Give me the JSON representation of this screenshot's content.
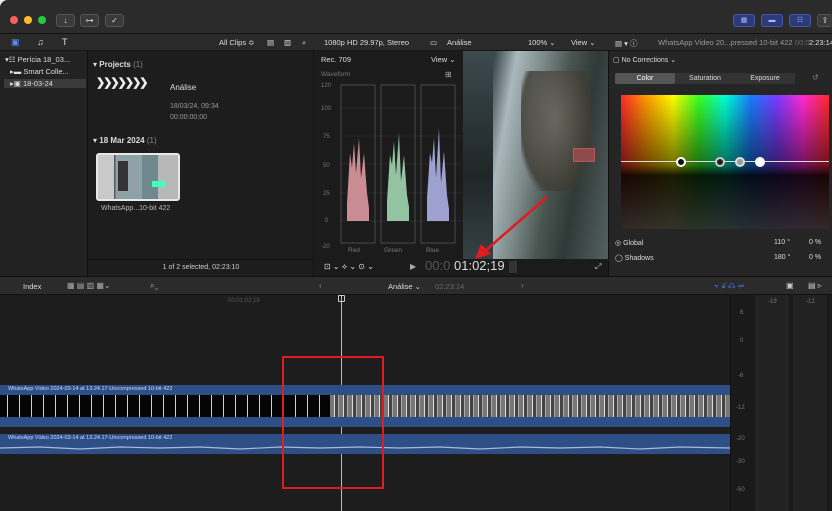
{
  "toolbar": {
    "all_clips": "All Clips ≎",
    "format": "1080p HD 29.97p, Stereo",
    "project_name": "Análise",
    "zoom": "100% ⌄",
    "view": "View ⌄",
    "clip_title": "WhatsApp Video 20...pressed 10-bit 422",
    "duration_dim": "00:0",
    "duration": "2:23:14"
  },
  "library": {
    "items": [
      "Perícia 18_03...",
      "Smart Colle...",
      "18-03-24"
    ]
  },
  "browser": {
    "projects_header": "Projects",
    "projects_count": "(1)",
    "project": {
      "name": "Análise",
      "date": "18/03/24, 09:34",
      "duration": "00:00:00;00"
    },
    "event_header": "18 Mar 2024",
    "event_count": "(1)",
    "clip_label": "WhatsApp...10-bit 422",
    "status": "1 of 2 selected, 02:23:10"
  },
  "scopes": {
    "title": "Rec. 709",
    "view": "View ⌄",
    "mode": "Waveform",
    "labels": [
      "120",
      "100",
      "75",
      "50",
      "25",
      "0",
      "-20"
    ],
    "channels": [
      "Red",
      "Green",
      "Blue"
    ]
  },
  "viewerbar": {
    "timecode_dim": "00:0",
    "timecode": "01:02;19"
  },
  "inspector": {
    "corrections": "No Corrections ⌄",
    "tabs": [
      "Color",
      "Saturation",
      "Exposure"
    ],
    "global": "Global",
    "global_value": "110 °",
    "global_pct": "0 %",
    "shadows": "Shadows",
    "shadows_value": "180 °",
    "shadows_pct": "0 %"
  },
  "timeline": {
    "index": "Index",
    "project": "Análise ⌄",
    "project_duration": "02:23:14",
    "ruler_tc": "00:01:02;19",
    "video_clip": "WhatsApp Video 2024-03-14 at 13.24.17-Uncompressed 10-bit 422",
    "audio_clip": "WhatsApp Video 2024-03-14 at 13.24.17-Uncompressed 10-bit 422"
  },
  "meters": {
    "top_labels": [
      "-19",
      "-12"
    ],
    "scale": [
      "6",
      "0",
      "-6",
      "-12",
      "-20",
      "-30",
      "-50"
    ]
  },
  "colors": {
    "accent": "#e11b22",
    "blue": "#2f4f8a",
    "clip_blue": "#3d5d9a"
  }
}
